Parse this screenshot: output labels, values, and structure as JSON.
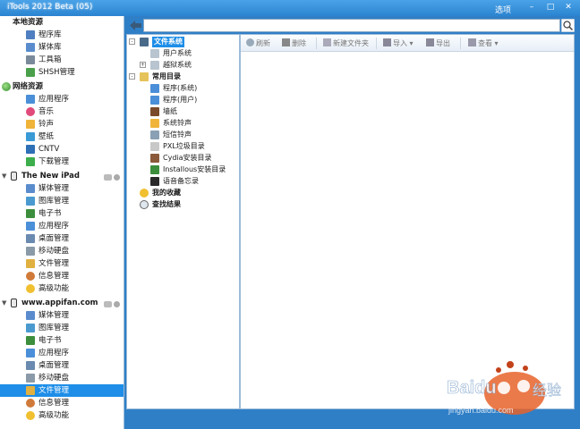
{
  "window": {
    "title": "iTools 2012 Beta (05)",
    "menu_label": "选项",
    "minimize_glyph": "–",
    "maximize_glyph": "□",
    "close_glyph": "✕"
  },
  "sidebar": {
    "local_section": "本地资源",
    "local_items": [
      "程序库",
      "媒体库",
      "工具箱",
      "SHSH管理"
    ],
    "network_section": "网络资源",
    "network_items": [
      "应用程序",
      "音乐",
      "铃声",
      "壁纸",
      "CNTV",
      "下载管理"
    ],
    "device1_section": "The New iPad",
    "device1_items": [
      "媒体管理",
      "图库管理",
      "电子书",
      "应用程序",
      "桌面管理",
      "移动硬盘",
      "文件管理",
      "信息管理",
      "高级功能"
    ],
    "device2_section": "www.appifan.com",
    "device2_items": [
      "媒体管理",
      "图库管理",
      "电子书",
      "应用程序",
      "桌面管理",
      "移动硬盘",
      "文件管理",
      "信息管理",
      "高级功能"
    ],
    "selected_item": "文件管理"
  },
  "search": {
    "value": ""
  },
  "tree": {
    "filesystem": "文件系统",
    "user_system": "用户系统",
    "jailbreak_system": "越狱系统",
    "common_dirs": "常用目录",
    "program_system": "程序(系统)",
    "program_user": "程序(用户)",
    "wallpaper": "墙纸",
    "system_ringtone": "系统铃声",
    "sms_ringtone": "短信铃声",
    "pxl_trash": "PXL垃圾目录",
    "cydia_dir": "Cydia安装目录",
    "installous_dir": "Installous安装目录",
    "voice_memo": "语音备忘录",
    "favorites": "我的收藏",
    "search_results": "查找结果",
    "expand_glyph": "-",
    "expand_plus": "+"
  },
  "toolbar": {
    "refresh": "刷新",
    "delete": "删除",
    "new_folder": "新建文件夹",
    "import": "导入",
    "export": "导出",
    "view": "查看",
    "dropdown_glyph": "▾"
  },
  "watermark": {
    "text1": "Baidu",
    "text2": "经验",
    "url": "jingyan.baidu.com"
  },
  "colors": {
    "accent": "#2f7fc7",
    "selection": "#1e8ee8"
  }
}
